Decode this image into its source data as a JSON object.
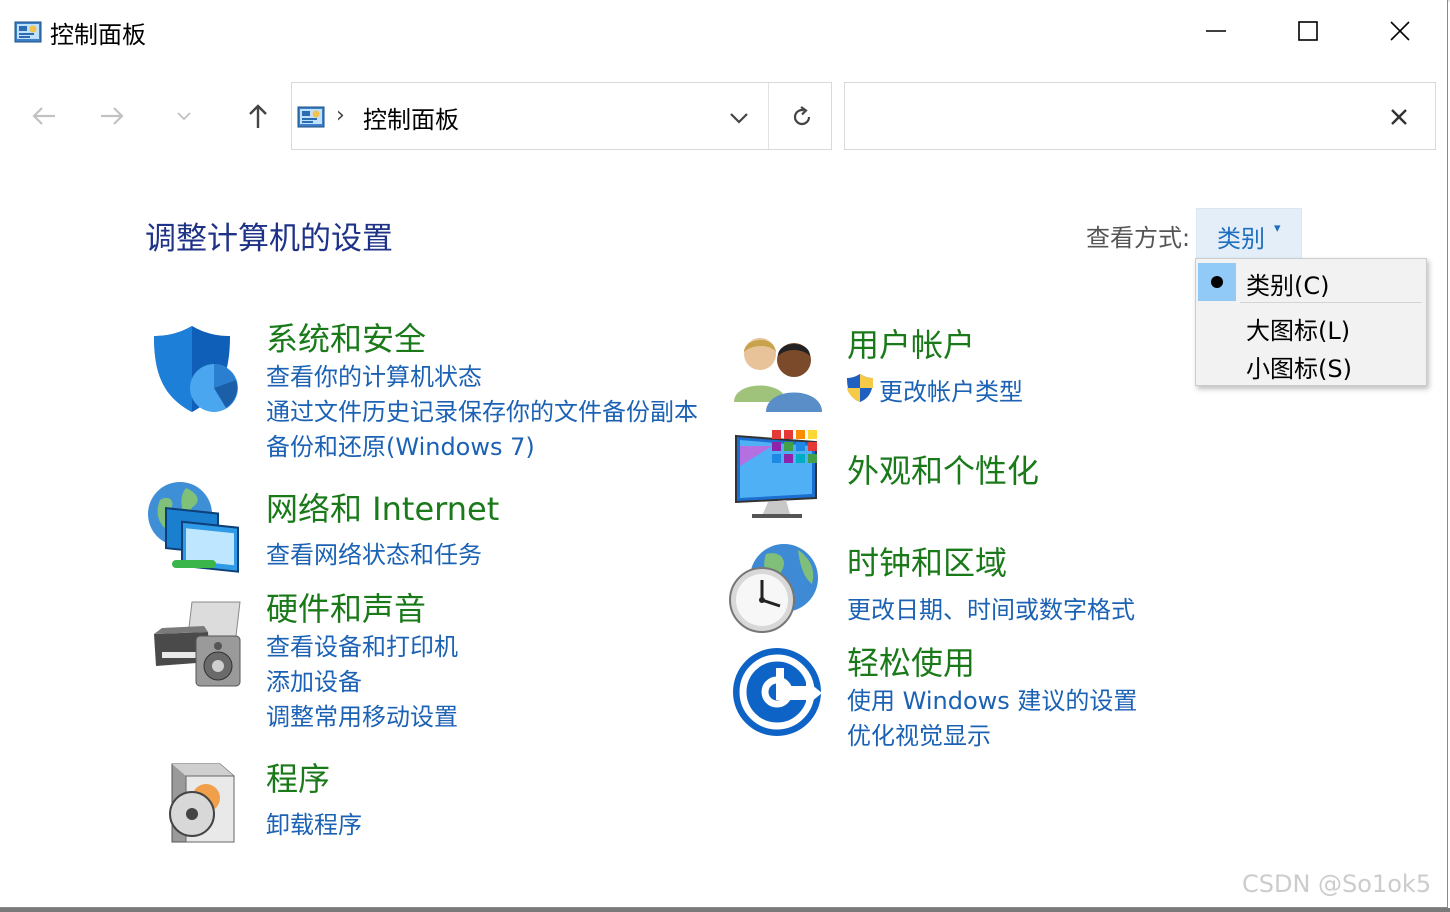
{
  "window": {
    "title": "控制面板",
    "minimize_label": "",
    "maximize_label": "",
    "close_label": ""
  },
  "nav": {
    "back": "←",
    "forward": "→",
    "recent": "⌄",
    "up": "↑"
  },
  "address": {
    "separator": "›",
    "location": "控制面板"
  },
  "search": {
    "value": "",
    "placeholder": ""
  },
  "heading": "调整计算机的设置",
  "view_by": {
    "label": "查看方式:",
    "selected": "类别",
    "options": [
      "类别(C)",
      "大图标(L)",
      "小图标(S)"
    ],
    "checked_index": 0
  },
  "categories": [
    {
      "title": "系统和安全",
      "links": [
        "查看你的计算机状态",
        "通过文件历史记录保存你的文件备份副本",
        "备份和还原(Windows 7)"
      ]
    },
    {
      "title": "网络和 Internet",
      "links": [
        "查看网络状态和任务"
      ]
    },
    {
      "title": "硬件和声音",
      "links": [
        "查看设备和打印机",
        "添加设备",
        "调整常用移动设置"
      ]
    },
    {
      "title": "程序",
      "links": [
        "卸载程序"
      ]
    },
    {
      "title": "用户帐户",
      "links": [
        "更改帐户类型"
      ]
    },
    {
      "title": "外观和个性化",
      "links": []
    },
    {
      "title": "时钟和区域",
      "links": [
        "更改日期、时间或数字格式"
      ]
    },
    {
      "title": "轻松使用",
      "links": [
        "使用 Windows 建议的设置",
        "优化视觉显示"
      ]
    }
  ],
  "watermark": "CSDN @So1ok5",
  "colors": {
    "heading": "#1e3287",
    "category_title": "#1a7a1a",
    "link": "#1c62b4",
    "menu_check": "#91c9f7"
  }
}
